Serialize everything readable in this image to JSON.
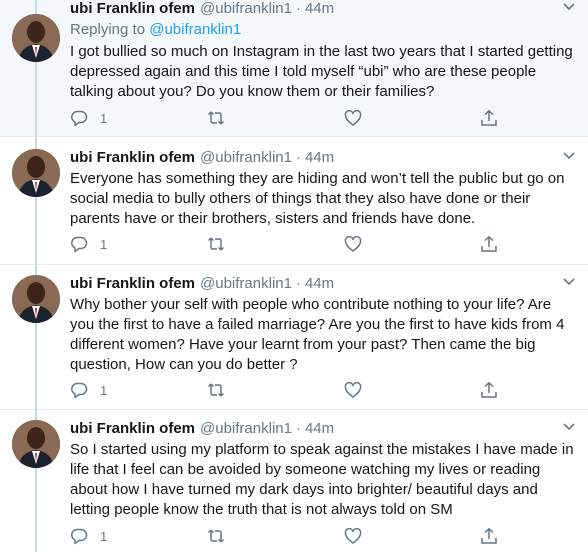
{
  "tweets": [
    {
      "name": "ubi Franklin ofem",
      "handle": "@ubifranklin1",
      "separator": "·",
      "time": "44m",
      "replying_prefix": "Replying to",
      "replying_handle": "@ubifranklin1",
      "text": "I got bullied so much on Instagram in the last two years that I started getting depressed again and this time I told myself “ubi” who are these people talking about you? Do you know them or their families?",
      "reply_count": "1"
    },
    {
      "name": "ubi Franklin ofem",
      "handle": "@ubifranklin1",
      "separator": "·",
      "time": "44m",
      "text": "Everyone has something they are hiding and won’t tell the public but go on social media to bully others of things that they also have done or their parents have or their brothers, sisters and friends have done.",
      "reply_count": "1"
    },
    {
      "name": "ubi Franklin ofem",
      "handle": "@ubifranklin1",
      "separator": "·",
      "time": "44m",
      "text": "Why bother your self with people who contribute nothing to your life? Are you the first to have a failed marriage? Are you the first to have kids from 4 different women? Have your learnt from your past? Then came the big question, How can you do better ?",
      "reply_count": "1"
    },
    {
      "name": "ubi Franklin ofem",
      "handle": "@ubifranklin1",
      "separator": "·",
      "time": "44m",
      "text": "So I started using my platform to speak against the mistakes I have made in life that I feel can be avoided by someone watching my lives or reading about how I have turned my dark days into brighter/ beautiful days and letting people know the truth that is not always told on SM",
      "reply_count": "1"
    }
  ],
  "icons": {
    "reply": "reply-icon",
    "retweet": "retweet-icon",
    "like": "heart-icon",
    "share": "share-icon",
    "menu": "chevron-down-icon",
    "avatar": "avatar"
  },
  "colors": {
    "link": "#1da1f2",
    "secondary_text": "#657786",
    "highlight_bg": "#f5f8fa",
    "thread_line": "#ccd6dd"
  }
}
